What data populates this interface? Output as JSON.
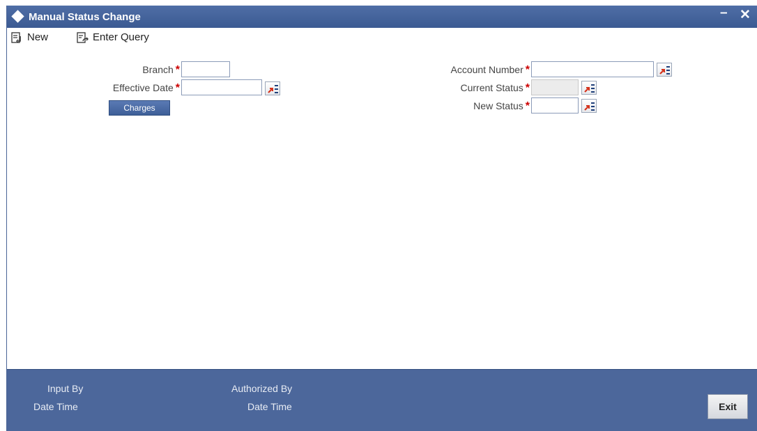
{
  "window": {
    "title": "Manual Status Change",
    "minimize_label": "–",
    "close_label": "✕"
  },
  "toolbar": {
    "new_label": "New",
    "enter_query_label": "Enter Query"
  },
  "form": {
    "branch_label": "Branch",
    "effective_date_label": "Effective Date",
    "charges_label": "Charges",
    "account_number_label": "Account Number",
    "current_status_label": "Current Status",
    "new_status_label": "New Status",
    "required_mark": "*",
    "branch_value": "",
    "effective_date_value": "",
    "account_number_value": "",
    "current_status_value": "",
    "new_status_value": ""
  },
  "footer": {
    "input_by_label": "Input By",
    "date_time_label_1": "Date Time",
    "authorized_by_label": "Authorized By",
    "date_time_label_2": "Date Time",
    "exit_label": "Exit"
  },
  "colors": {
    "titlebar": "#3b5a92",
    "footer": "#4c679b",
    "required": "#cc0000"
  }
}
